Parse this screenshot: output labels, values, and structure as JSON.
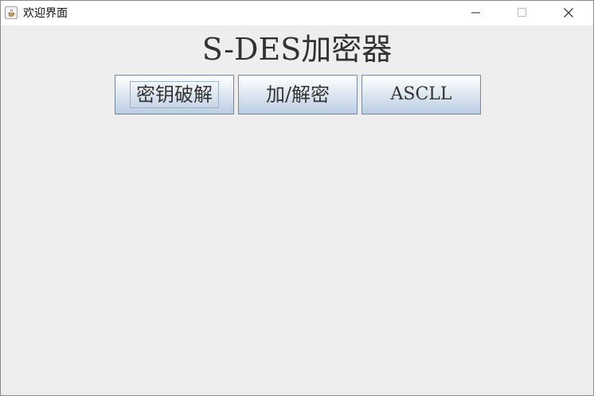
{
  "window": {
    "title": "欢迎界面",
    "icon": "java-cup-icon",
    "controls": [
      "minimize-icon",
      "maximize-icon",
      "close-icon"
    ]
  },
  "main": {
    "heading": "S-DES加密器",
    "buttons": [
      {
        "label": "密钥破解",
        "focused": true
      },
      {
        "label": "加/解密"
      },
      {
        "label": "ASCLL"
      }
    ]
  },
  "colors": {
    "background": "#eeeeee",
    "titlebar": "#ffffff",
    "button_top": "#ffffff",
    "button_bottom": "#b9cde3",
    "button_border": "#7a8a9c",
    "text": "#333333"
  }
}
